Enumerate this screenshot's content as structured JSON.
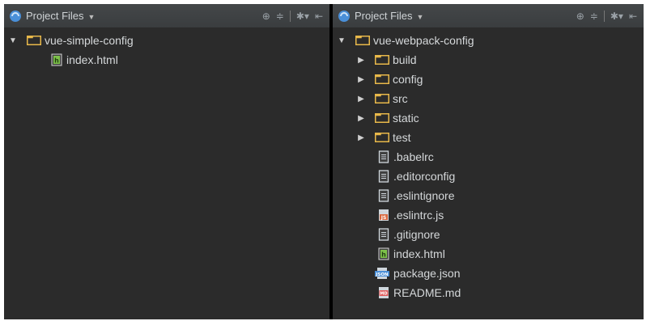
{
  "left_pane": {
    "header": {
      "title": "Project Files"
    },
    "tree": {
      "root_label": "vue-simple-config",
      "files": [
        {
          "label": "index.html",
          "icon": "html-file-icon"
        }
      ]
    }
  },
  "right_pane": {
    "header": {
      "title": "Project Files"
    },
    "tree": {
      "root_label": "vue-webpack-config",
      "folders": [
        {
          "label": "build"
        },
        {
          "label": "config"
        },
        {
          "label": "src"
        },
        {
          "label": "static"
        },
        {
          "label": "test"
        }
      ],
      "files": [
        {
          "label": ".babelrc",
          "icon": "text-file-icon"
        },
        {
          "label": ".editorconfig",
          "icon": "text-file-icon"
        },
        {
          "label": ".eslintignore",
          "icon": "text-file-icon"
        },
        {
          "label": ".eslintrc.js",
          "icon": "js-file-icon"
        },
        {
          "label": ".gitignore",
          "icon": "text-file-icon"
        },
        {
          "label": "index.html",
          "icon": "html-file-icon"
        },
        {
          "label": "package.json",
          "icon": "json-file-icon"
        },
        {
          "label": "README.md",
          "icon": "markdown-file-icon"
        }
      ]
    }
  },
  "colors": {
    "panel_bg": "#2b2b2b",
    "toolbar_bg": "#3c3f41",
    "folder": "#e8b84a",
    "html_icon": "#7ec24a",
    "js_icon": "#d9663c",
    "json_icon": "#4a8fd8",
    "md_icon": "#e05a5a"
  }
}
